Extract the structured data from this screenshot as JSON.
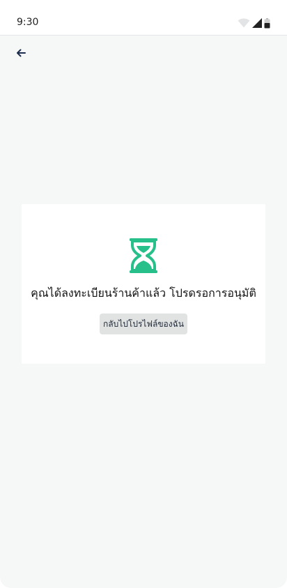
{
  "status_bar": {
    "time": "9:30",
    "icons": [
      "wifi-icon",
      "signal-icon",
      "battery-icon"
    ]
  },
  "app_bar": {
    "back_icon": "arrow-left-icon"
  },
  "card": {
    "icon": "hourglass-icon",
    "message": "คุณได้ลงทะเบียนร้านค้าแล้ว โปรดรอการอนุมัติ",
    "button_label": "กลับไปโปรไฟล์ของฉัน"
  },
  "colors": {
    "accent": "#27c08a",
    "background": "#f6f8f8",
    "card": "#ffffff",
    "button_bg": "#e1e3e3",
    "back_arrow": "#1c2c4c"
  }
}
